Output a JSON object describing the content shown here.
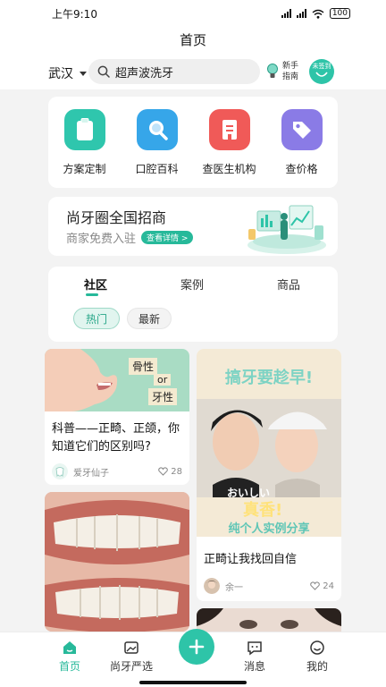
{
  "status_bar": {
    "time": "上午9:10",
    "battery": "100"
  },
  "header": {
    "title": "首页",
    "city": "武汉",
    "search_text": "超声波洗牙",
    "newbie_line1": "新手",
    "newbie_line2": "指南",
    "checkin_label": "未签到"
  },
  "quick_menu": [
    {
      "label": "方案定制",
      "icon": "clipboard-icon",
      "color": "#2fc6ad"
    },
    {
      "label": "口腔百科",
      "icon": "magnifier-icon",
      "color": "#36a6e9"
    },
    {
      "label": "查医生机构",
      "icon": "building-icon",
      "color": "#f05a58"
    },
    {
      "label": "查价格",
      "icon": "price-tag-icon",
      "color": "#8a7be6"
    }
  ],
  "banner": {
    "title": "尚牙圈全国招商",
    "subtitle": "商家免费入驻",
    "button": "查看详情 >"
  },
  "community": {
    "tabs": [
      "社区",
      "案例",
      "商品"
    ],
    "active_tab": "社区",
    "chips": [
      "热门",
      "最新"
    ],
    "active_chip": "热门"
  },
  "posts": [
    {
      "image_text_1": "骨性",
      "image_text_2": "or",
      "image_text_3": "牙性",
      "title": "科普——正畸、正颌，你知道它们的区别吗?",
      "author": "爱牙仙子",
      "likes": "28"
    },
    {
      "image_headline": "搞牙要趁早!",
      "image_caption_1": "おいしい",
      "image_caption_2": "真香!",
      "image_caption_3": "纯个人实例分享",
      "title": "正畸让我找回自信",
      "author": "余一",
      "likes": "24"
    }
  ],
  "bottom_nav": [
    {
      "label": "首页",
      "icon": "home-icon",
      "active": true
    },
    {
      "label": "尚牙严选",
      "icon": "picture-icon",
      "active": false
    },
    {
      "label": "消息",
      "icon": "chat-icon",
      "active": false
    },
    {
      "label": "我的",
      "icon": "profile-icon",
      "active": false
    }
  ],
  "colors": {
    "accent": "#27b99a"
  }
}
